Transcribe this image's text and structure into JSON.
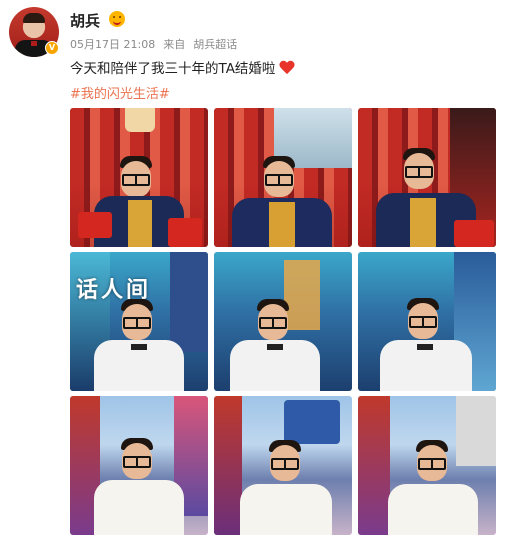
{
  "post": {
    "author": "胡兵",
    "verified_badge": "V",
    "date": "05月17日 21:08",
    "source_prefix": "来自",
    "source": "胡兵超话",
    "content": "今天和陪伴了我三十年的TA结婚啦",
    "hashtag": "#我的闪光生活#"
  },
  "watermark": "话人间",
  "photos": [
    {
      "theme": "red"
    },
    {
      "theme": "red"
    },
    {
      "theme": "red"
    },
    {
      "theme": "blue"
    },
    {
      "theme": "blue"
    },
    {
      "theme": "blue"
    },
    {
      "theme": "street"
    },
    {
      "theme": "street"
    },
    {
      "theme": "street"
    }
  ],
  "colors": {
    "hashtag": "#eb7350",
    "meta": "#8a8a8a",
    "heart": "#e8342a",
    "verified": "#f7a500"
  },
  "icons": [
    "verified-icon",
    "emoji-icon",
    "red-heart-icon"
  ]
}
